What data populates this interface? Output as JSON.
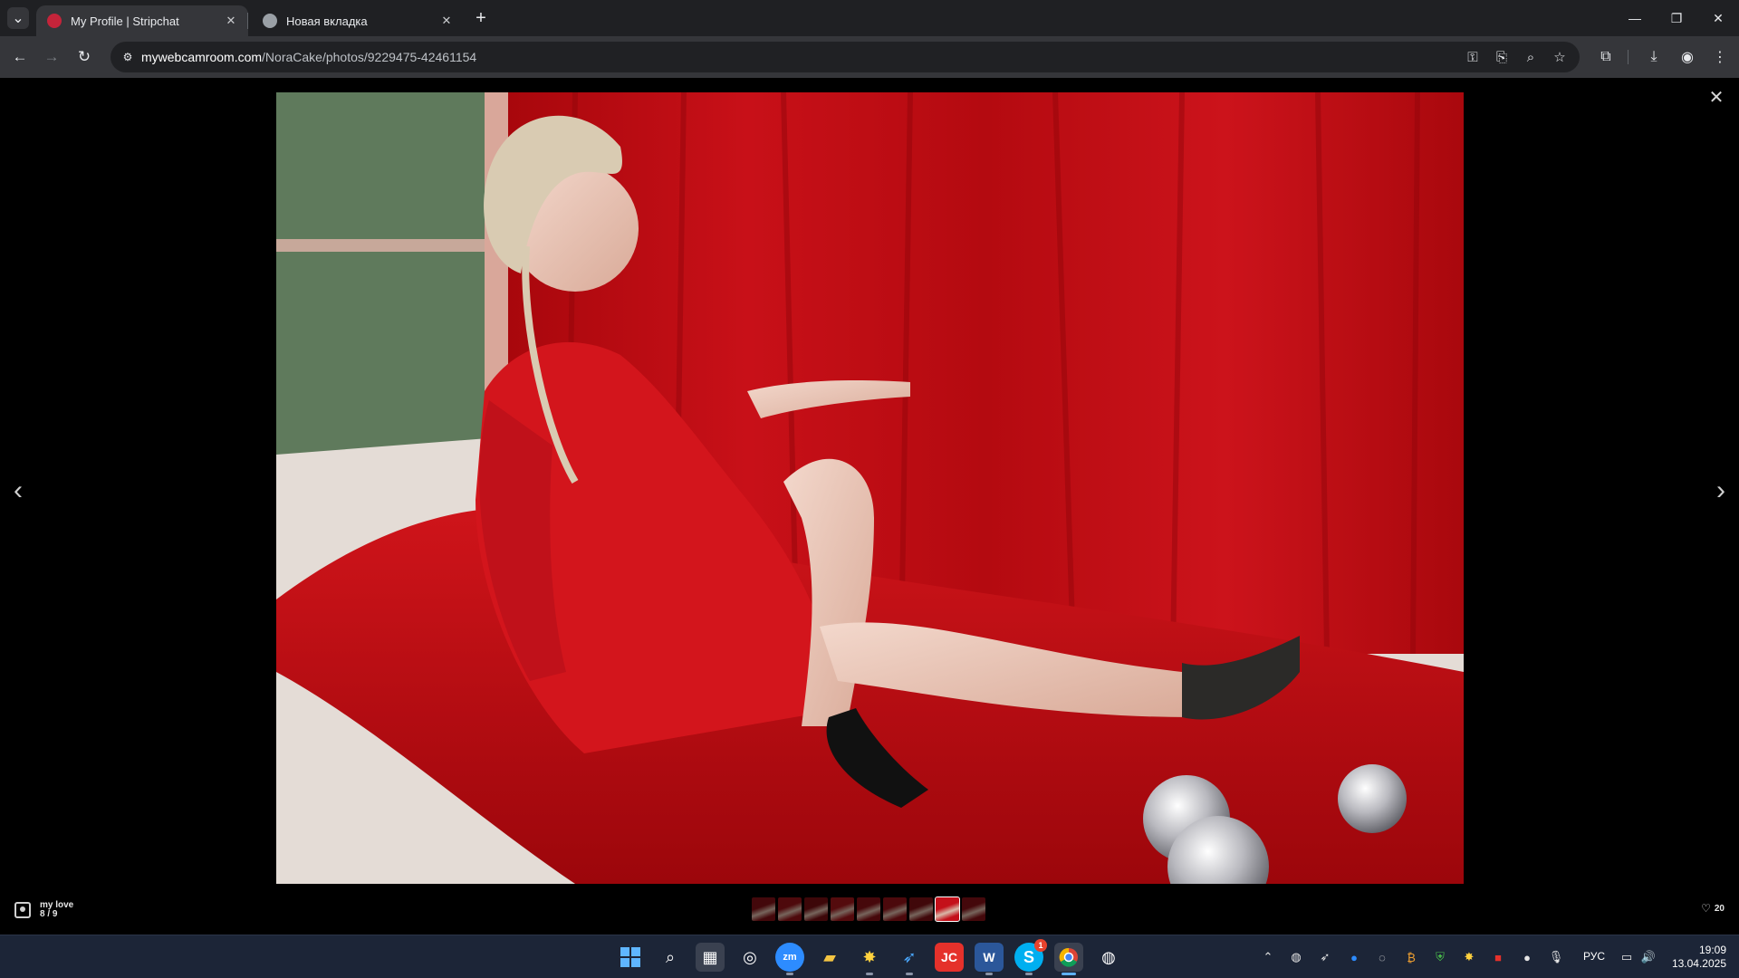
{
  "browser": {
    "tabs": [
      {
        "title": "My Profile | Stripchat",
        "active": true
      },
      {
        "title": "Новая вкладка",
        "active": false
      }
    ],
    "tab_search_icon": "chevron-down-icon",
    "new_tab_icon": "plus-icon",
    "url_host": "mywebcamroom.com",
    "url_path": "/NoraCake/photos/9229475-42461154",
    "window_controls": [
      "minimize",
      "restore",
      "close"
    ]
  },
  "viewer": {
    "album_title": "my love",
    "album_position": "8 / 9",
    "likes": "20",
    "thumbnail_count": 9,
    "active_thumbnail": 8,
    "colors": {
      "accent_red": "#c4101a",
      "background": "#000000"
    }
  },
  "taskbar": {
    "language": "РУС",
    "time": "19:09",
    "date": "13.04.2025",
    "apps": [
      "windows-start",
      "search",
      "calculator",
      "browser-app",
      "zoom",
      "file-explorer",
      "burst-app",
      "feather-app",
      "jc-app",
      "word",
      "skype",
      "chrome",
      "obs"
    ],
    "skype_badge": "1"
  }
}
